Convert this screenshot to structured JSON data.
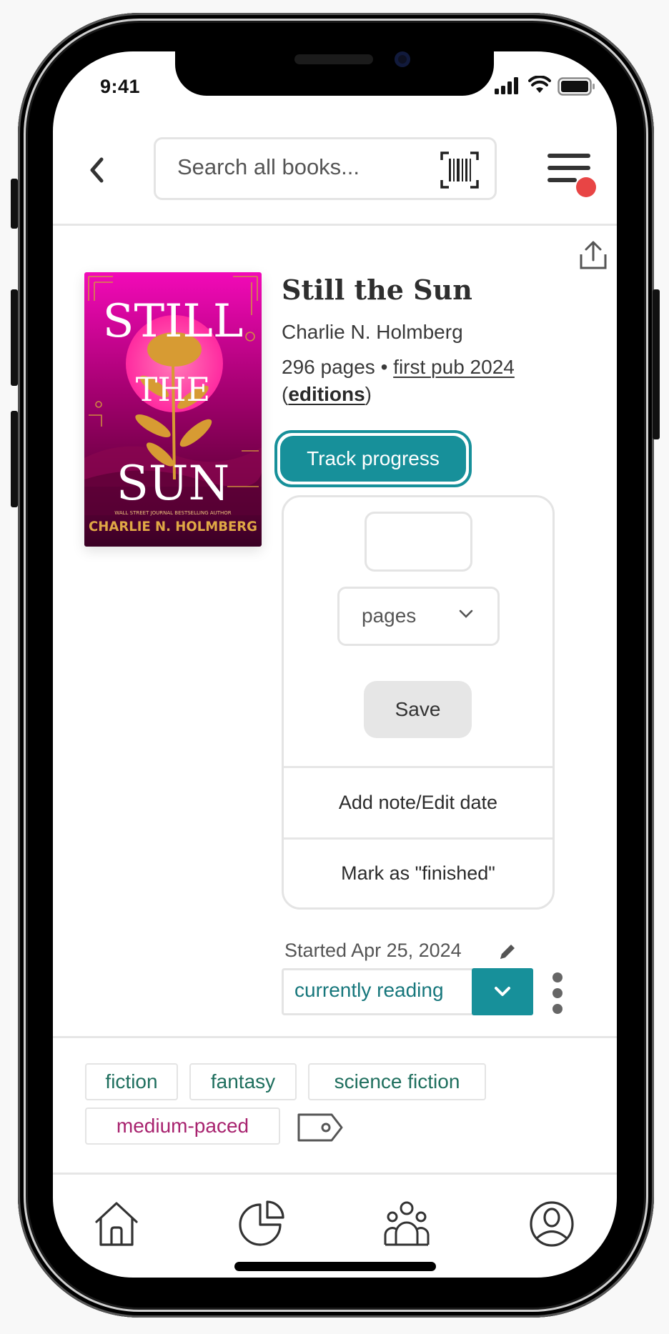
{
  "status_bar": {
    "time": "9:41",
    "icons": [
      "signal-icon",
      "wifi-icon",
      "battery-icon"
    ]
  },
  "header": {
    "back_icon": "chevron-left-icon",
    "search": {
      "placeholder": "Search all books...",
      "value": ""
    },
    "barcode_icon": "barcode-scan-icon",
    "menu_icon": "menu-icon",
    "notification_dot_color": "#e84545"
  },
  "book": {
    "share_icon": "share-icon",
    "cover": {
      "title_line1": "STILL",
      "title_line2": "THE",
      "title_line3": "SUN",
      "tagline": "WALL STREET JOURNAL BESTSELLING AUTHOR",
      "author": "CHARLIE N. HOLMBERG"
    },
    "title": "Still the Sun",
    "author": "Charlie N. Holmberg",
    "pages": "296 pages",
    "separator": "•",
    "first_pub": "first pub 2024",
    "editions_open": "(",
    "editions_label": "editions",
    "editions_close": ")"
  },
  "progress": {
    "track_button_label": "Track progress",
    "progress_input": {
      "value": "",
      "placeholder": ""
    },
    "unit_select": {
      "selected": "pages"
    },
    "save_label": "Save",
    "add_note_label": "Add note/Edit date",
    "mark_finished_label": "Mark as \"finished\""
  },
  "reading_status": {
    "started_label": "Started Apr 25, 2024",
    "edit_icon": "pencil-icon",
    "status_value": "currently reading",
    "more_icon": "more-vertical-icon"
  },
  "tags": [
    {
      "label": "fiction",
      "color": "#1f6f5e"
    },
    {
      "label": "fantasy",
      "color": "#1f6f5e"
    },
    {
      "label": "science fiction",
      "color": "#1f6f5e"
    },
    {
      "label": "medium-paced",
      "color": "#a8236f"
    }
  ],
  "tag_add_icon": "tag-icon",
  "bottom_nav": [
    {
      "name": "home",
      "icon": "home-icon"
    },
    {
      "name": "stats",
      "icon": "pie-chart-icon"
    },
    {
      "name": "community",
      "icon": "people-icon"
    },
    {
      "name": "profile",
      "icon": "profile-icon"
    }
  ],
  "colors": {
    "accent": "#17909a",
    "status_text": "#17777c",
    "tag_green": "#1f6f5e",
    "tag_pink": "#a8236f",
    "border": "#e4e4e4"
  }
}
